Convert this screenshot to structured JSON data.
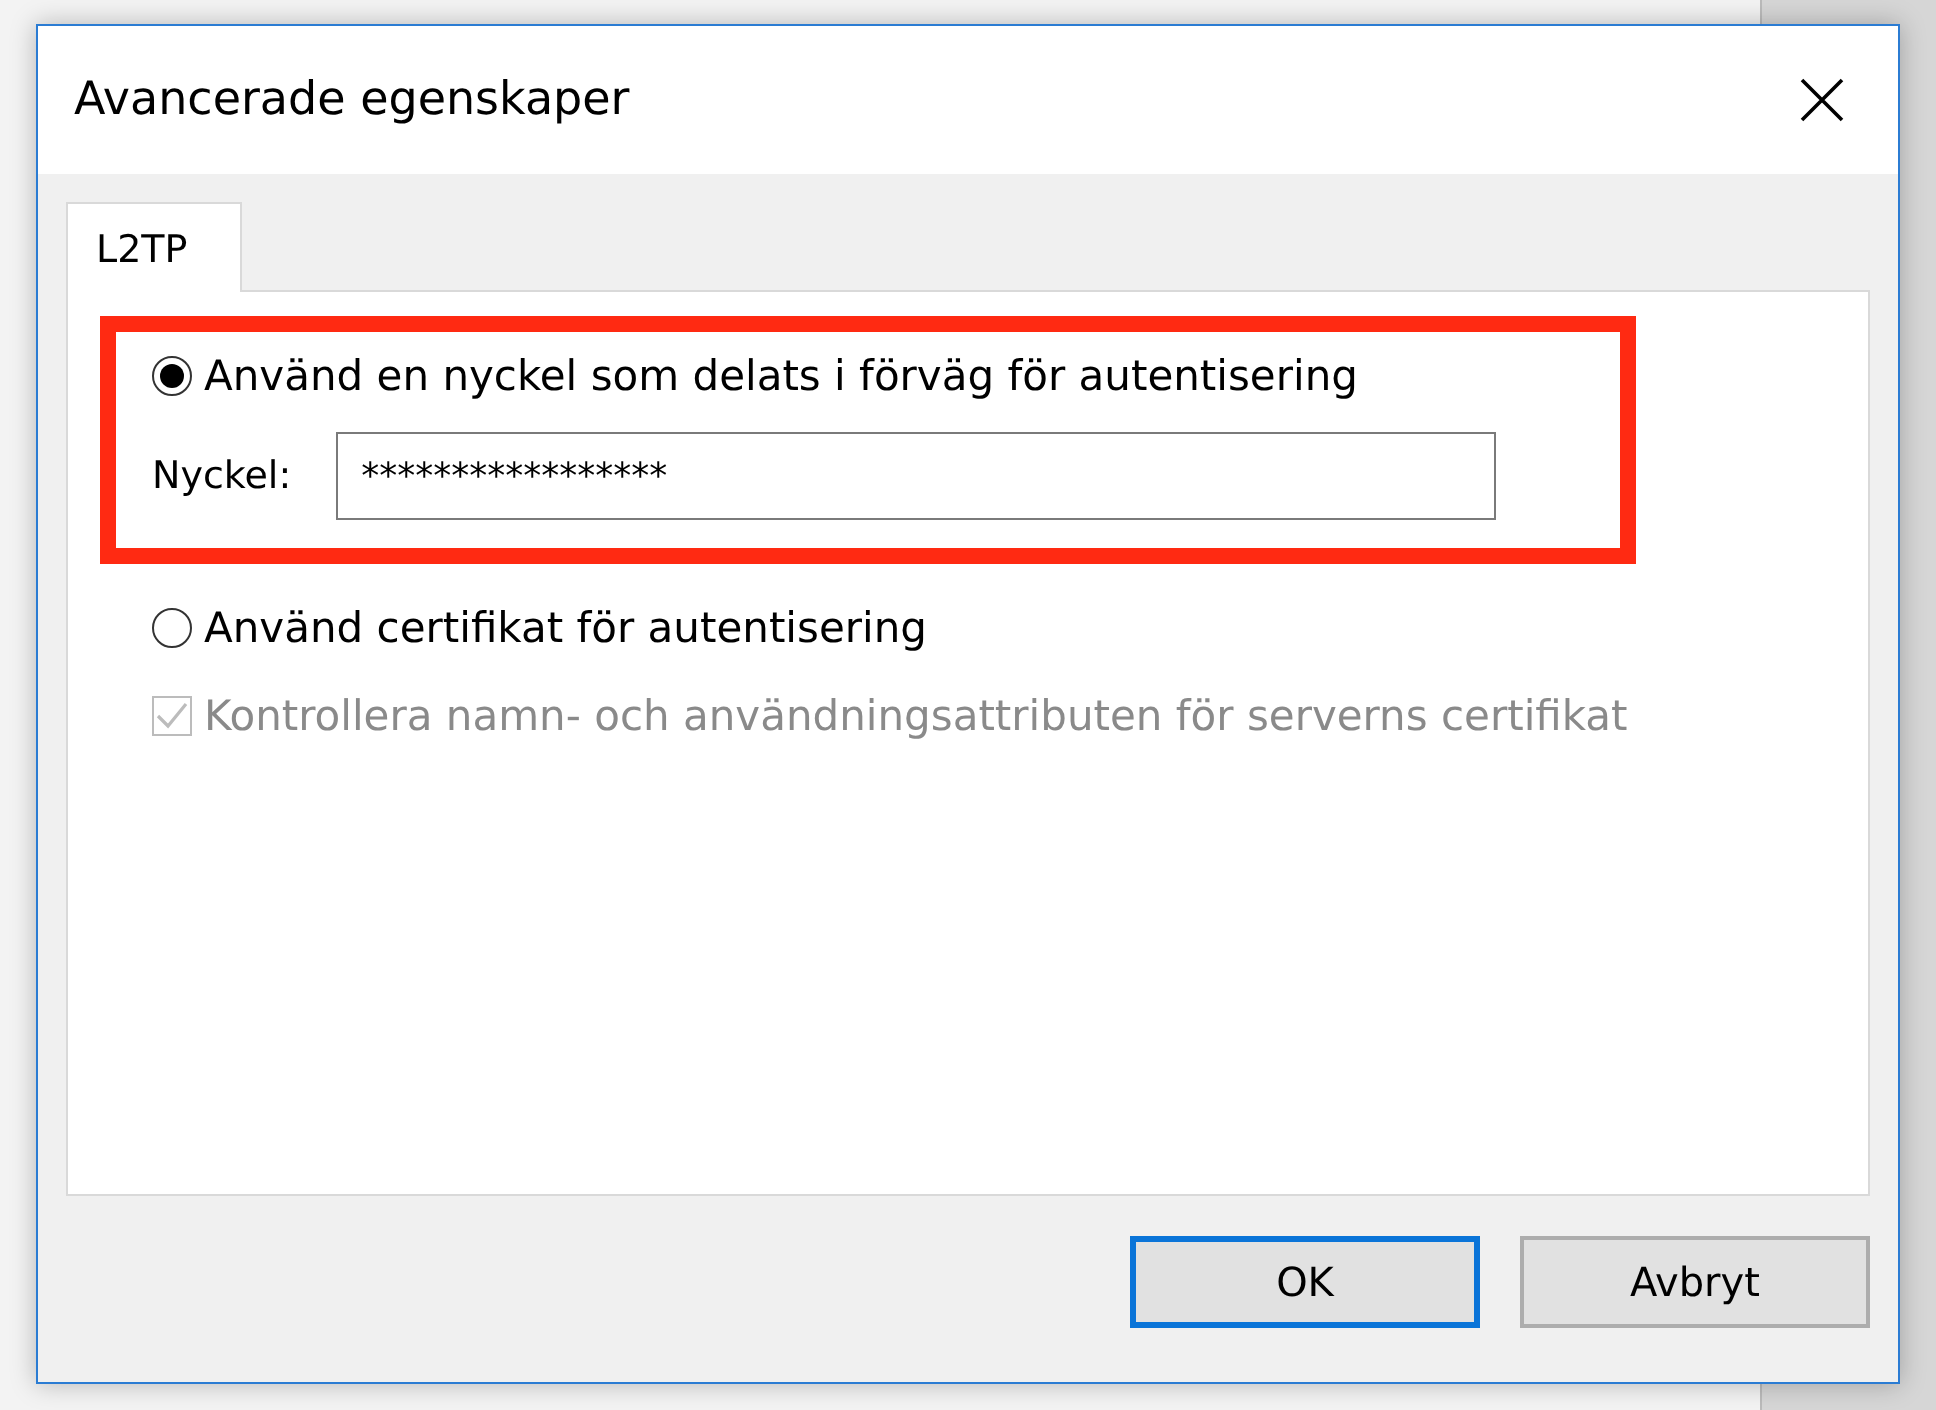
{
  "window": {
    "title": "Avancerade egenskaper"
  },
  "tabs": [
    {
      "label": "L2TP",
      "selected": true
    }
  ],
  "options": [
    {
      "kind": "radio",
      "label": "Använd en nyckel som delats i förväg för autentisering",
      "selected": true,
      "highlighted": true,
      "field": {
        "label": "Nyckel:",
        "value": "*****************"
      }
    },
    {
      "kind": "radio",
      "label": "Använd certifikat för autentisering",
      "selected": false,
      "highlighted": false
    },
    {
      "kind": "checkbox",
      "label": "Kontrollera namn- och användningsattributen för serverns certifikat",
      "checked": true,
      "disabled": true
    }
  ],
  "buttons": [
    {
      "label": "OK",
      "default": true
    },
    {
      "label": "Avbryt",
      "default": false
    }
  ]
}
